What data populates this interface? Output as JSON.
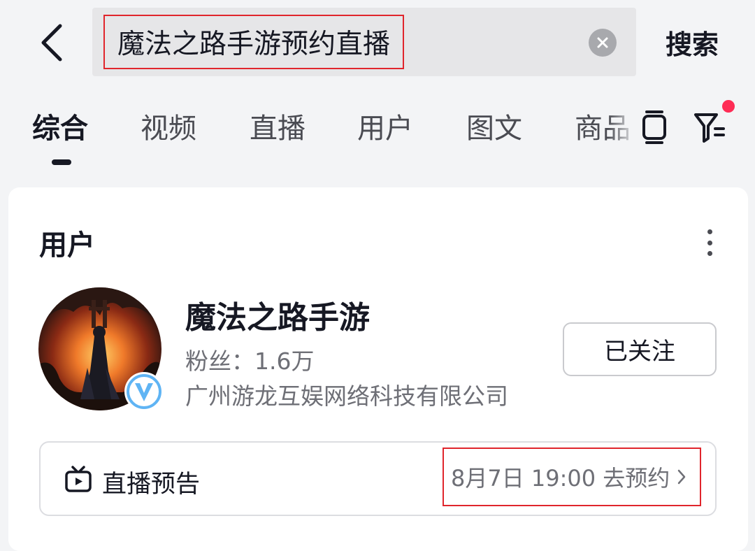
{
  "search": {
    "query": "魔法之路手游预约直播",
    "submit_label": "搜索"
  },
  "tabs": [
    {
      "label": "综合",
      "active": true
    },
    {
      "label": "视频"
    },
    {
      "label": "直播"
    },
    {
      "label": "用户"
    },
    {
      "label": "图文"
    },
    {
      "label": "商品"
    }
  ],
  "icons": {
    "back": "back-arrow-icon",
    "clear": "clear-icon",
    "layout": "layout-toggle-icon",
    "filter": "filter-icon",
    "more": "more-vertical-icon",
    "verified": "verified-v-icon",
    "tv": "tv-icon",
    "arrow": "chevron-right-icon"
  },
  "colors": {
    "accent": "#fe2c55",
    "highlight_border": "#e0252c",
    "verified_blue": "#5fb4f4"
  },
  "user_card": {
    "section_title": "用户",
    "name": "魔法之路手游",
    "fans": "粉丝：1.6万",
    "company": "广州游龙互娱网络科技有限公司",
    "follow_label": "已关注",
    "live": {
      "label": "直播预告",
      "time_text": "8月7日 19:00 去预约"
    }
  }
}
